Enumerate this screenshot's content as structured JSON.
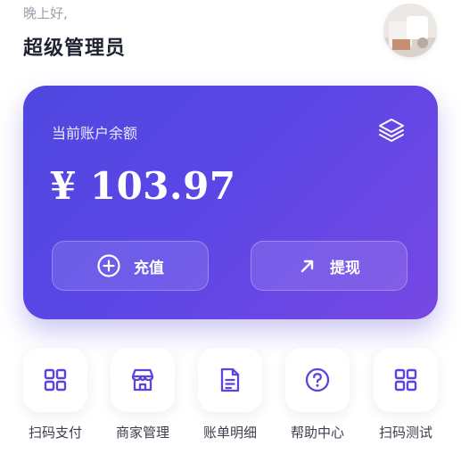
{
  "header": {
    "greeting": "晚上好,",
    "admin_name": "超级管理员"
  },
  "balance_card": {
    "label": "当前账户余额",
    "amount": "¥ 103.97",
    "recharge_label": "充值",
    "withdraw_label": "提现"
  },
  "menu": [
    {
      "label": "扫码支付",
      "icon": "grid-icon"
    },
    {
      "label": "商家管理",
      "icon": "store-icon"
    },
    {
      "label": "账单明细",
      "icon": "document-icon"
    },
    {
      "label": "帮助中心",
      "icon": "help-icon"
    },
    {
      "label": "扫码测试",
      "icon": "grid-icon"
    }
  ],
  "colors": {
    "accent": "#5a45e0",
    "card_gradient_start": "#4f47df",
    "card_gradient_end": "#7747e3"
  }
}
